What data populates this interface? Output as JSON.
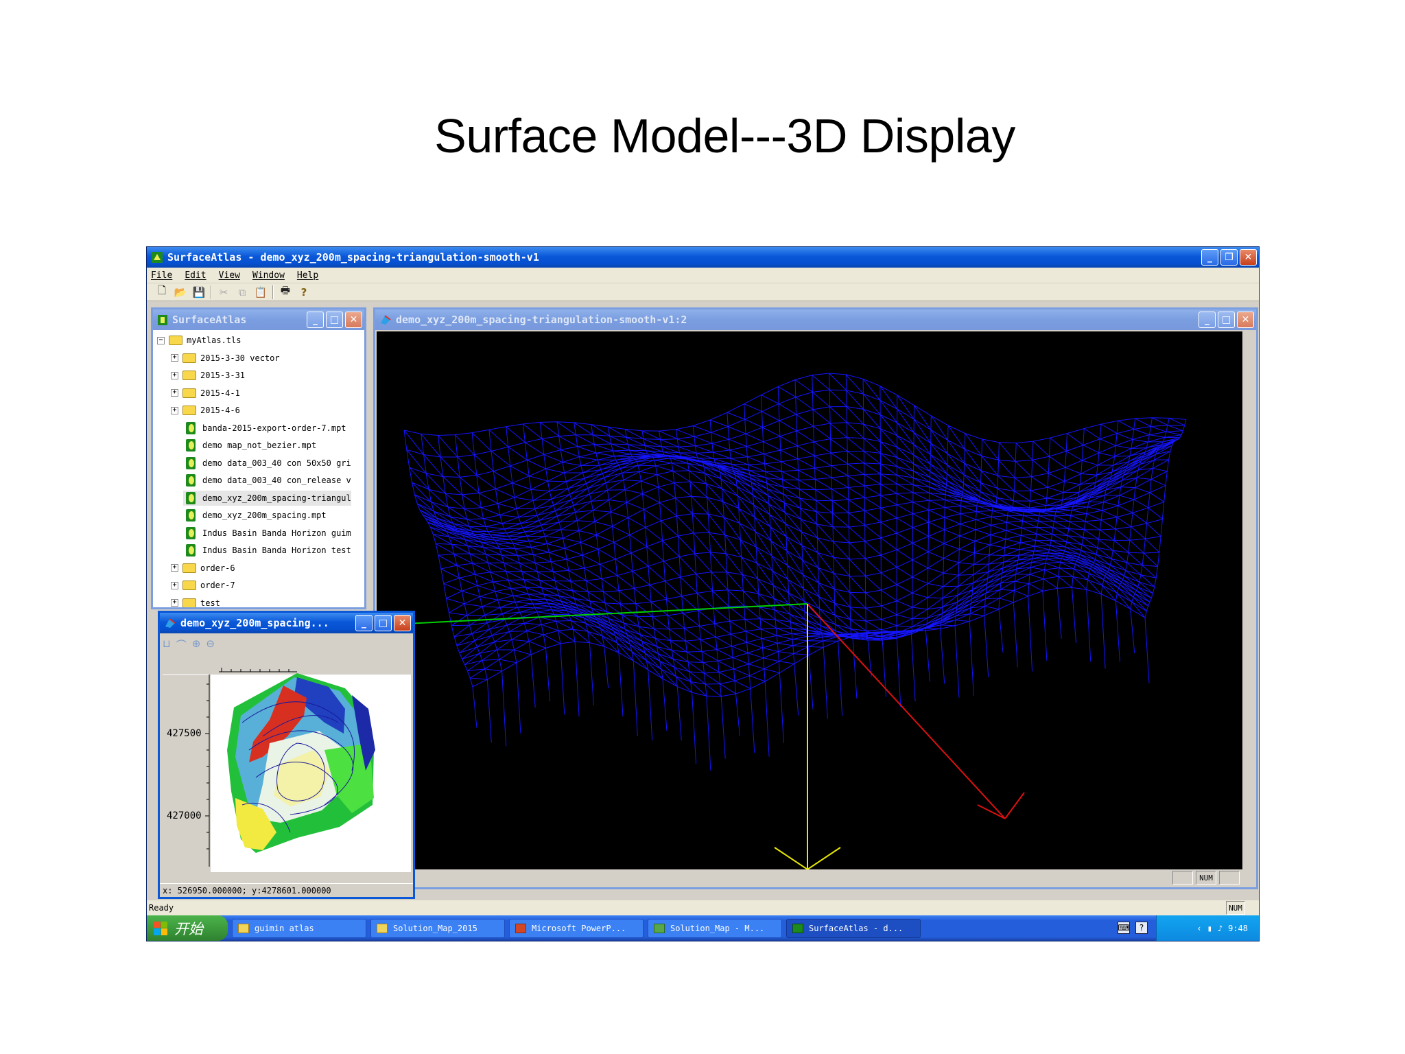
{
  "slide": {
    "title": "Surface Model---3D Display"
  },
  "app": {
    "title": "SurfaceAtlas - demo_xyz_200m_spacing-triangulation-smooth-v1",
    "menu": [
      "File",
      "Edit",
      "View",
      "Window",
      "Help"
    ],
    "toolbar": [
      "new-icon",
      "open-icon",
      "save-icon",
      "cut-icon",
      "copy-icon",
      "paste-icon",
      "print-icon",
      "help-icon"
    ],
    "status": "Ready",
    "num_indicator": "NUM"
  },
  "tree_panel": {
    "title": "SurfaceAtlas",
    "root": "myAtlas.tls",
    "items": [
      {
        "label": "2015-3-30 vector",
        "type": "folder"
      },
      {
        "label": "2015-3-31",
        "type": "folder"
      },
      {
        "label": "2015-4-1",
        "type": "folder"
      },
      {
        "label": "2015-4-6",
        "type": "folder"
      },
      {
        "label": "banda-2015-export-order-7.mpt",
        "type": "map"
      },
      {
        "label": "demo  map_not_bezier.mpt",
        "type": "map"
      },
      {
        "label": "demo data_003_40 con 50x50 gri",
        "type": "map"
      },
      {
        "label": "demo data_003_40 con_release v",
        "type": "map"
      },
      {
        "label": "demo_xyz_200m_spacing-triangul",
        "type": "map",
        "selected": true
      },
      {
        "label": "demo_xyz_200m_spacing.mpt",
        "type": "map"
      },
      {
        "label": "Indus Basin Banda Horizon guim",
        "type": "map"
      },
      {
        "label": "Indus Basin Banda Horizon test",
        "type": "map"
      },
      {
        "label": "order-6",
        "type": "folder"
      },
      {
        "label": "order-7",
        "type": "folder"
      },
      {
        "label": "test",
        "type": "folder"
      }
    ]
  },
  "view3d": {
    "title": "demo_xyz_200m_spacing-triangulation-smooth-v1:2",
    "num_indicator": "NUM",
    "colors": {
      "mesh": "#1414ff",
      "axis_x": "#00d000",
      "axis_y": "#e01010",
      "axis_z": "#e8e800"
    }
  },
  "map_window": {
    "title": "demo_xyz_200m_spacing...",
    "tools": [
      "ruler-icon",
      "curve-icon",
      "zoom-in-icon",
      "zoom-out-icon"
    ],
    "y_ticks": [
      "427500",
      "427000"
    ],
    "coords": "x: 526950.000000; y:4278601.000000"
  },
  "taskbar": {
    "start_label": "开始",
    "tasks": [
      "guimin atlas",
      "Solution_Map_2015",
      "Microsoft PowerP...",
      "Solution_Map - M...",
      "SurfaceAtlas - d..."
    ],
    "clock": "9:48"
  }
}
